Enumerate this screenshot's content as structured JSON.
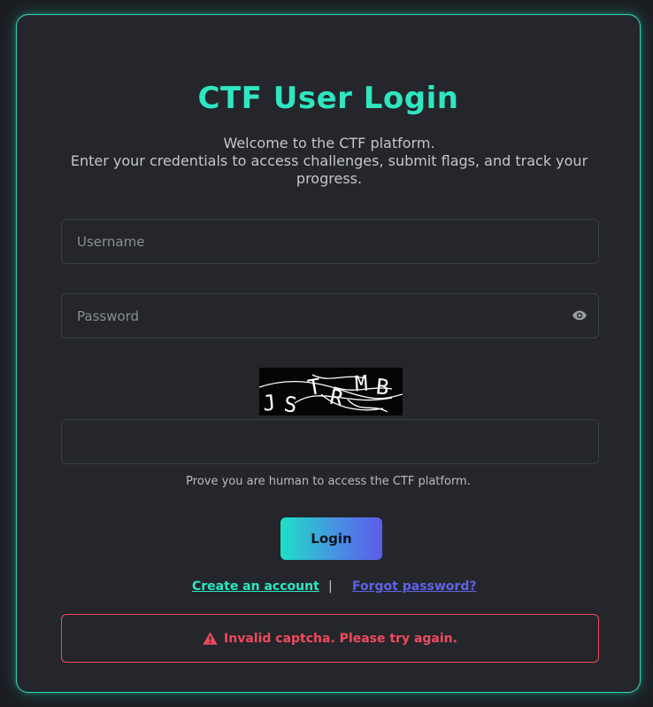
{
  "login": {
    "title": "CTF User Login",
    "subtitle_line1": "Welcome to the CTF platform.",
    "subtitle_line2": "Enter your credentials to access challenges, submit flags, and track your progress.",
    "username_placeholder": "Username",
    "password_placeholder": "Password",
    "password_toggle_icon": "eye-icon",
    "captcha_text": "JSTRMB",
    "captcha_answer_value": "",
    "captcha_hint": "Prove you are human to access the CTF platform.",
    "login_label": "Login",
    "create_account_label": "Create an account",
    "separator": "|",
    "forgot_password_label": "Forgot password?",
    "error_icon": "warning-icon",
    "error_message": "Invalid captcha. Please try again."
  },
  "colors": {
    "accent": "#2ee6c0",
    "link_secondary": "#5f62e8",
    "error": "#f04a5c",
    "card_background": "#24262b",
    "page_background": "#1b1d22"
  }
}
